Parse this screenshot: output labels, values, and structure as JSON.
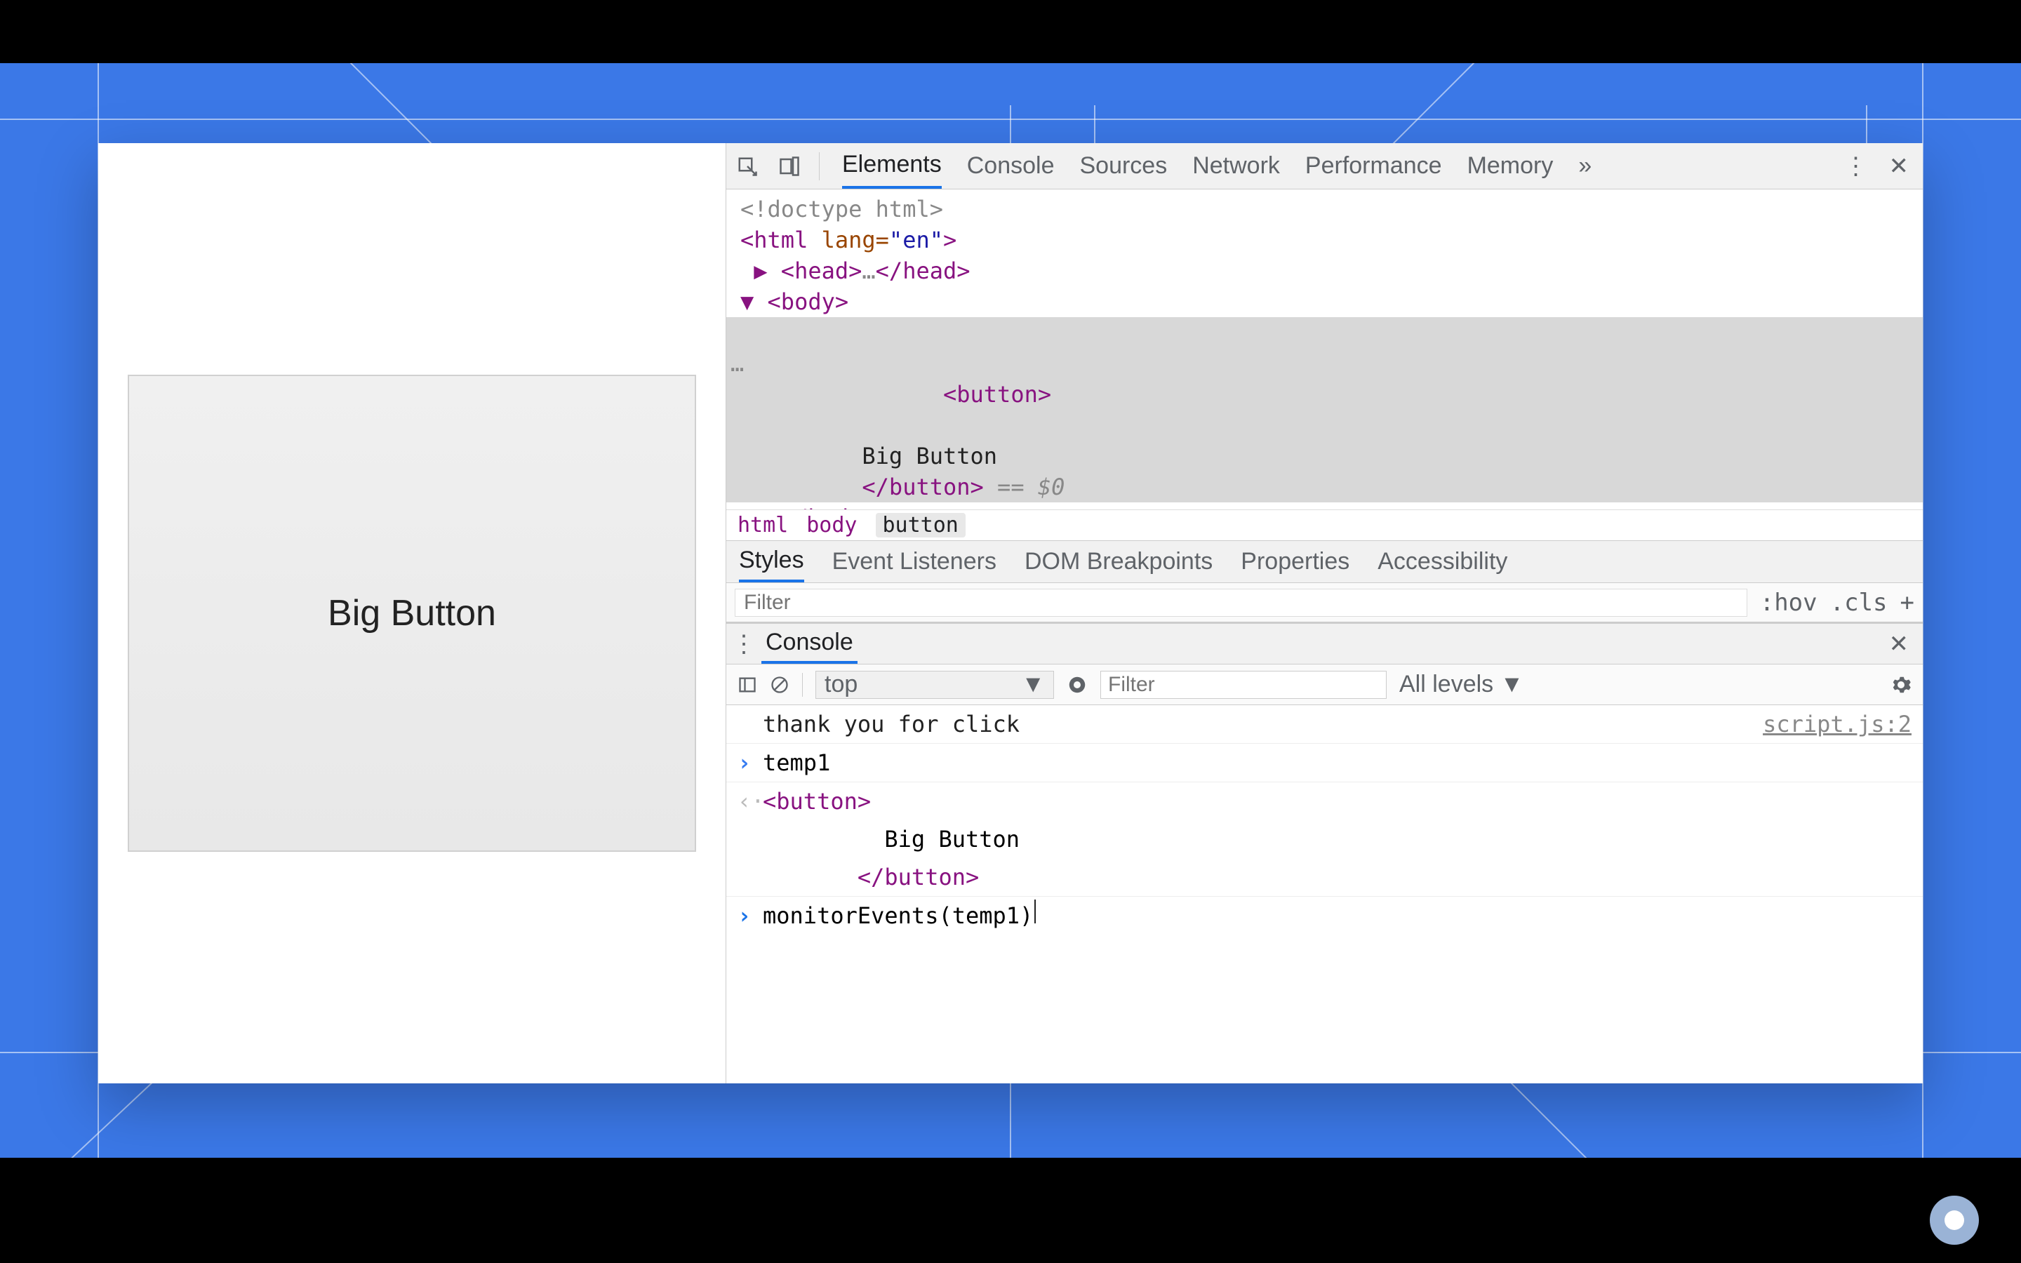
{
  "page": {
    "button_label": "Big Button"
  },
  "devtools": {
    "tabs": [
      "Elements",
      "Console",
      "Sources",
      "Network",
      "Performance",
      "Memory"
    ],
    "active_tab": "Elements",
    "dom": {
      "line0": "<!doctype html>",
      "line1_open": "<html",
      "line1_attr": " lang=",
      "line1_val": "\"en\"",
      "line1_close": ">",
      "line2": "▶ <head>…</head>",
      "line3": "▼ <body>",
      "selected_open": "   <button>",
      "selected_text": "         Big Button",
      "selected_close": "       </button>",
      "selected_eq0": " == $0",
      "line_end": "   </body>",
      "ellipsis": "…"
    },
    "breadcrumbs": [
      "html",
      "body",
      "button"
    ],
    "subtabs": [
      "Styles",
      "Event Listeners",
      "DOM Breakpoints",
      "Properties",
      "Accessibility"
    ],
    "filter_placeholder": "Filter",
    "filter_buttons": {
      "hov": ":hov",
      "cls": ".cls",
      "plus": "+"
    }
  },
  "console": {
    "drawer_tab": "Console",
    "context": "top",
    "filter_placeholder": "Filter",
    "levels": "All levels ▼",
    "log_msg": "thank you for click",
    "log_src": "script.js:2",
    "input1": "temp1",
    "out_open": "   <button>",
    "out_text": "         Big Button",
    "out_close": "       </button>",
    "input2": "monitorEvents(temp1)"
  }
}
